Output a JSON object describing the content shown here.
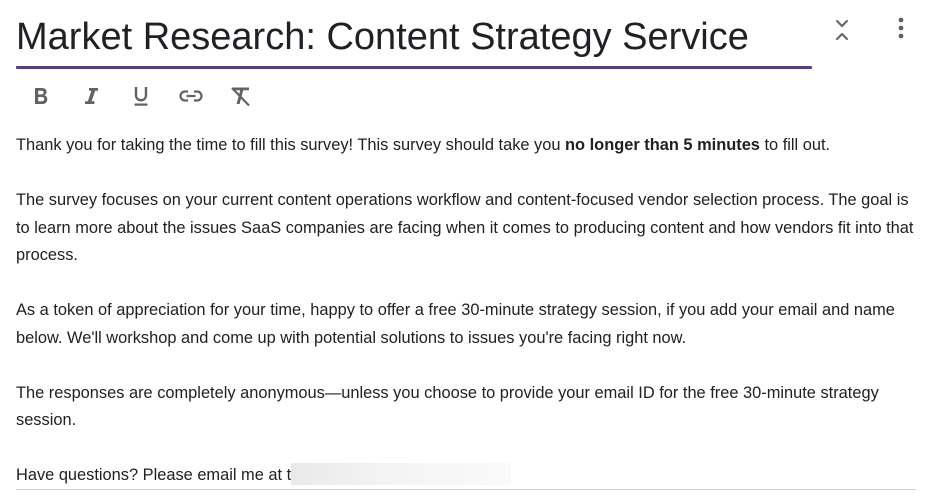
{
  "form": {
    "title": "Market Research: Content Strategy Service",
    "accent_color": "#5b3a8c",
    "header_actions": {
      "collapse_icon": "collapse-vertical-icon",
      "more_icon": "more-vert-icon"
    },
    "toolbar": [
      {
        "name": "bold",
        "icon": "bold-icon"
      },
      {
        "name": "italic",
        "icon": "italic-icon"
      },
      {
        "name": "underline",
        "icon": "underline-icon"
      },
      {
        "name": "link",
        "icon": "link-icon"
      },
      {
        "name": "clear-formatting",
        "icon": "clear-formatting-icon"
      }
    ],
    "description": {
      "p1_before": "Thank you for taking the time to fill this survey! This survey should take you ",
      "p1_bold": "no longer than 5 minutes",
      "p1_after": " to fill out.",
      "p2": "The survey focuses on your current content operations workflow and content-focused vendor selection process. The goal is to learn more about the issues SaaS companies are facing when it comes to producing content and how vendors fit into that process.",
      "p3": "As a token of appreciation for your time, happy to offer a free 30-minute strategy session, if you add your email and name below. We'll workshop and come up with potential solutions to issues you're facing right now.",
      "p4": "The responses are completely anonymous—unless you choose to provide your email ID for the free 30-minute strategy session.",
      "p5": "Have questions? Please email me at t"
    }
  }
}
